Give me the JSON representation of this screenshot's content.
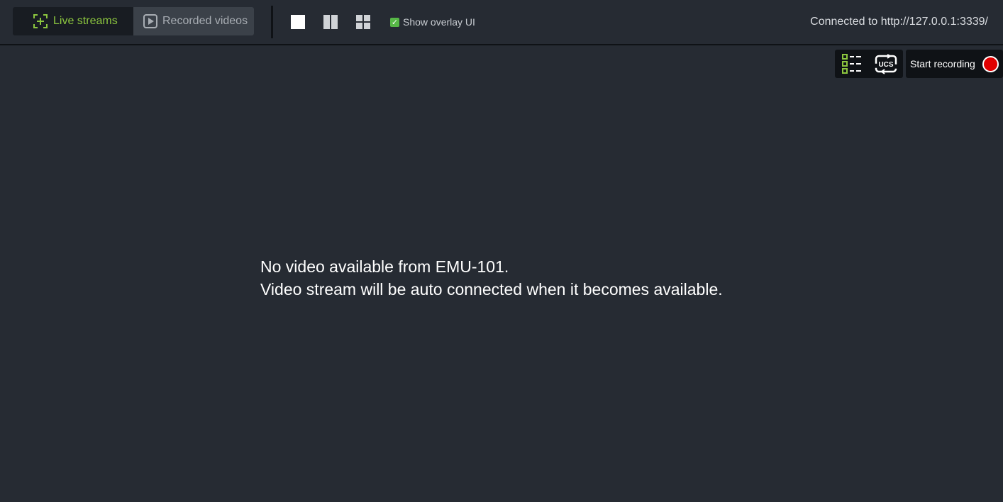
{
  "tabs": {
    "live": {
      "label": "Live streams",
      "icon": "live-stream-icon"
    },
    "recorded": {
      "label": "Recorded videos",
      "icon": "play-icon"
    }
  },
  "layout_buttons": [
    "single-view-icon",
    "two-column-view-icon",
    "grid-view-icon"
  ],
  "overlay_toggle": {
    "label": "Show overlay UI",
    "checked": true
  },
  "connection": {
    "text": "Connected to http://127.0.0.1:3339/"
  },
  "tools": {
    "list_icon": "checklist-icon",
    "ucs_icon": "ucs-switch-icon",
    "ucs_text": "UCS"
  },
  "record": {
    "label": "Start recording",
    "icon": "record-icon"
  },
  "message": {
    "line1": "No video available from EMU-101.",
    "line2": "Video stream will be auto connected when it becomes available."
  },
  "colors": {
    "background": "#262b33",
    "accent": "#8cc63f",
    "record": "#e00000",
    "checkbox": "#57b847"
  }
}
